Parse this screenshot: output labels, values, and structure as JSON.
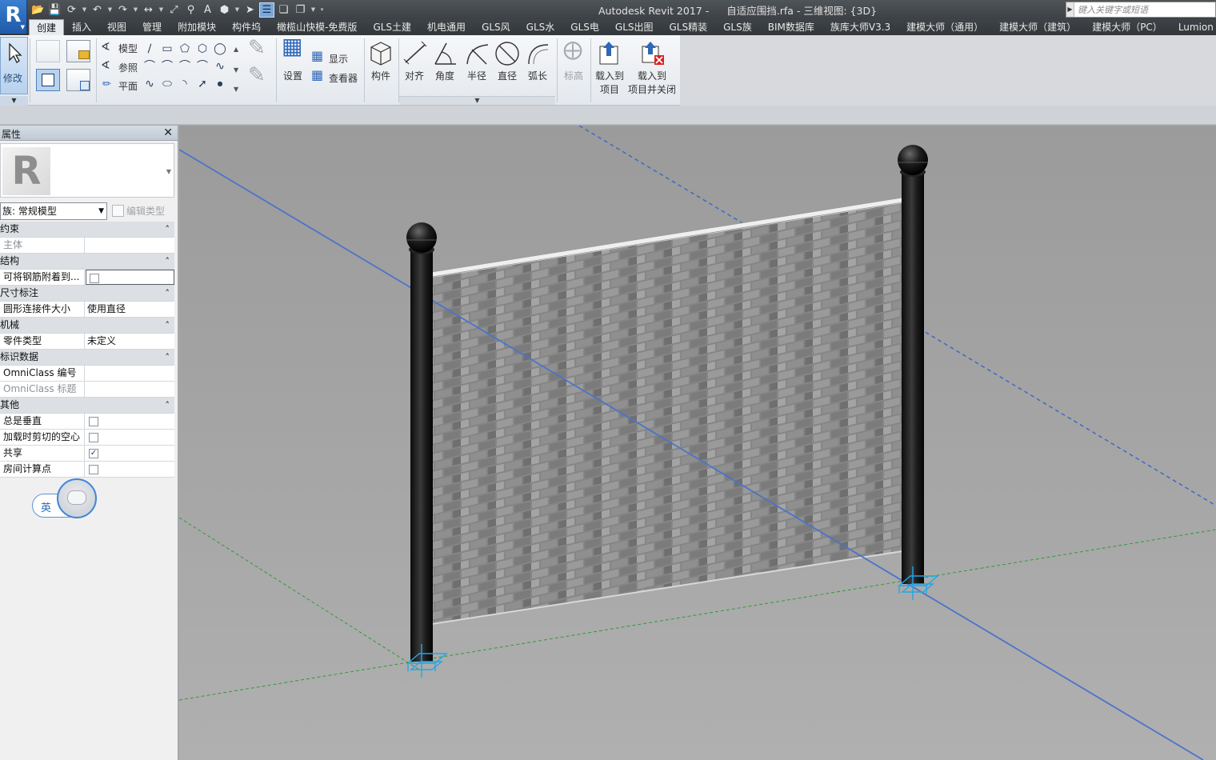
{
  "title_bar": {
    "app_name": "Autodesk Revit 2017 -",
    "file_and_view": "自适应围挡.rfa - 三维视图: {3D}",
    "search_placeholder": "键入关键字或短语"
  },
  "ribbon_tabs": [
    {
      "label": "创建",
      "active": true
    },
    {
      "label": "插入"
    },
    {
      "label": "视图"
    },
    {
      "label": "管理"
    },
    {
      "label": "附加模块"
    },
    {
      "label": "构件坞"
    },
    {
      "label": "橄榄山快模-免费版"
    },
    {
      "label": "GLS土建"
    },
    {
      "label": "机电通用"
    },
    {
      "label": "GLS风"
    },
    {
      "label": "GLS水"
    },
    {
      "label": "GLS电"
    },
    {
      "label": "GLS出图"
    },
    {
      "label": "GLS精装"
    },
    {
      "label": "GLS族"
    },
    {
      "label": "BIM数据库"
    },
    {
      "label": "族库大师V3.3"
    },
    {
      "label": "建模大师（通用）"
    },
    {
      "label": "建模大师（建筑）"
    },
    {
      "label": "建模大师（PC）"
    },
    {
      "label": "Lumion"
    }
  ],
  "ribbon": {
    "modify": "修改",
    "model_line": "模型",
    "ref_line": "参照",
    "plane": "平面",
    "set": "设置",
    "show": "显示",
    "viewer": "查看器",
    "component": "构件",
    "align": "对齐",
    "angular": "角度",
    "radial": "半径",
    "diameter": "直径",
    "arc_length": "弧长",
    "elevation": "标高",
    "load_into_project": "载入到\n项目",
    "load_into_project_l1": "载入到",
    "load_into_project_l2": "项目",
    "load_and_close_l1": "载入到",
    "load_and_close_l2": "项目并关闭"
  },
  "properties": {
    "title": "属性",
    "family": "族: 常规模型",
    "edit_type": "编辑类型",
    "groups": [
      {
        "name": "约束",
        "rows": [
          {
            "key": "主体",
            "value": "",
            "dim": true
          }
        ]
      },
      {
        "name": "结构",
        "rows": [
          {
            "key": "可将钢筋附着到...",
            "checkbox": false,
            "boxed": true
          }
        ]
      },
      {
        "name": "尺寸标注",
        "rows": [
          {
            "key": "圆形连接件大小",
            "value": "使用直径"
          }
        ]
      },
      {
        "name": "机械",
        "rows": [
          {
            "key": "零件类型",
            "value": "未定义"
          }
        ]
      },
      {
        "name": "标识数据",
        "rows": [
          {
            "key": "OmniClass 编号",
            "value": ""
          },
          {
            "key": "OmniClass 标题",
            "value": "",
            "dim": true
          }
        ]
      },
      {
        "name": "其他",
        "rows": [
          {
            "key": "总是垂直",
            "checkbox": false
          },
          {
            "key": "加载时剪切的空心",
            "checkbox": false
          },
          {
            "key": "共享",
            "checkbox": true
          },
          {
            "key": "房间计算点",
            "checkbox": false
          }
        ]
      }
    ]
  },
  "ime": {
    "label": "英"
  },
  "colors": {
    "titlebar": "#43474b",
    "accent_blue": "#2f67b8",
    "ref_plane_blue": "#4a74c9",
    "ref_plane_green": "#2f9a3a",
    "connector_cyan": "#1ea8e6",
    "viewport_bg": "#a6a6a6"
  }
}
